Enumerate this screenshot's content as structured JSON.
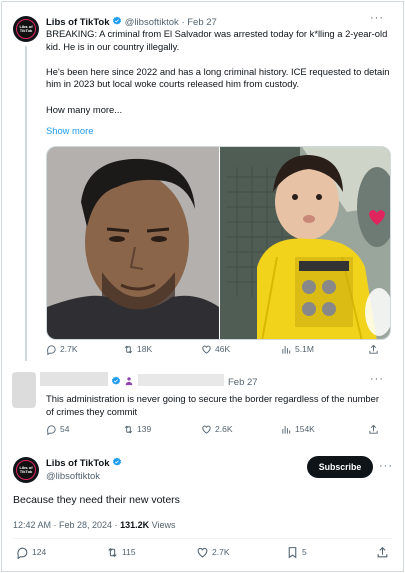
{
  "tweet": {
    "author_name": "Libs of TikTok",
    "author_handle": "@libsoftiktok",
    "separator": "·",
    "date": "Feb 27",
    "paragraphs": [
      "BREAKING: A criminal from El Salvador was arrested today for k*lling a 2-year-old kid. He is in our country illegally.",
      "He's been here since 2022 and has a long criminal history. ICE requested to detain him in 2023 but local woke courts released him from custody.",
      "How many more..."
    ],
    "show_more": "Show more",
    "stats": {
      "replies": "2.7K",
      "reposts": "18K",
      "likes": "46K",
      "views": "5.1M"
    }
  },
  "reply": {
    "date": "Feb 27",
    "text": "This administration is never going to secure the border regardless of the number of crimes they commit",
    "stats": {
      "replies": "54",
      "reposts": "139",
      "likes": "2.6K",
      "views": "154K"
    }
  },
  "main": {
    "author_name": "Libs of TikTok",
    "author_handle": "@libsoftiktok",
    "subscribe_label": "Subscribe",
    "text": "Because they need their new voters",
    "time": "12:42 AM · Feb 28, 2024 ·",
    "views_count": "131.2K",
    "views_label": "Views",
    "stats": {
      "replies": "124",
      "reposts": "115",
      "likes": "2.7K",
      "bookmarks": "5"
    }
  },
  "avatar_text": "Libs of TikTok",
  "colors": {
    "accent": "#1d9bf0",
    "text": "#0f1419",
    "muted": "#536471",
    "border": "#cfd9de"
  }
}
